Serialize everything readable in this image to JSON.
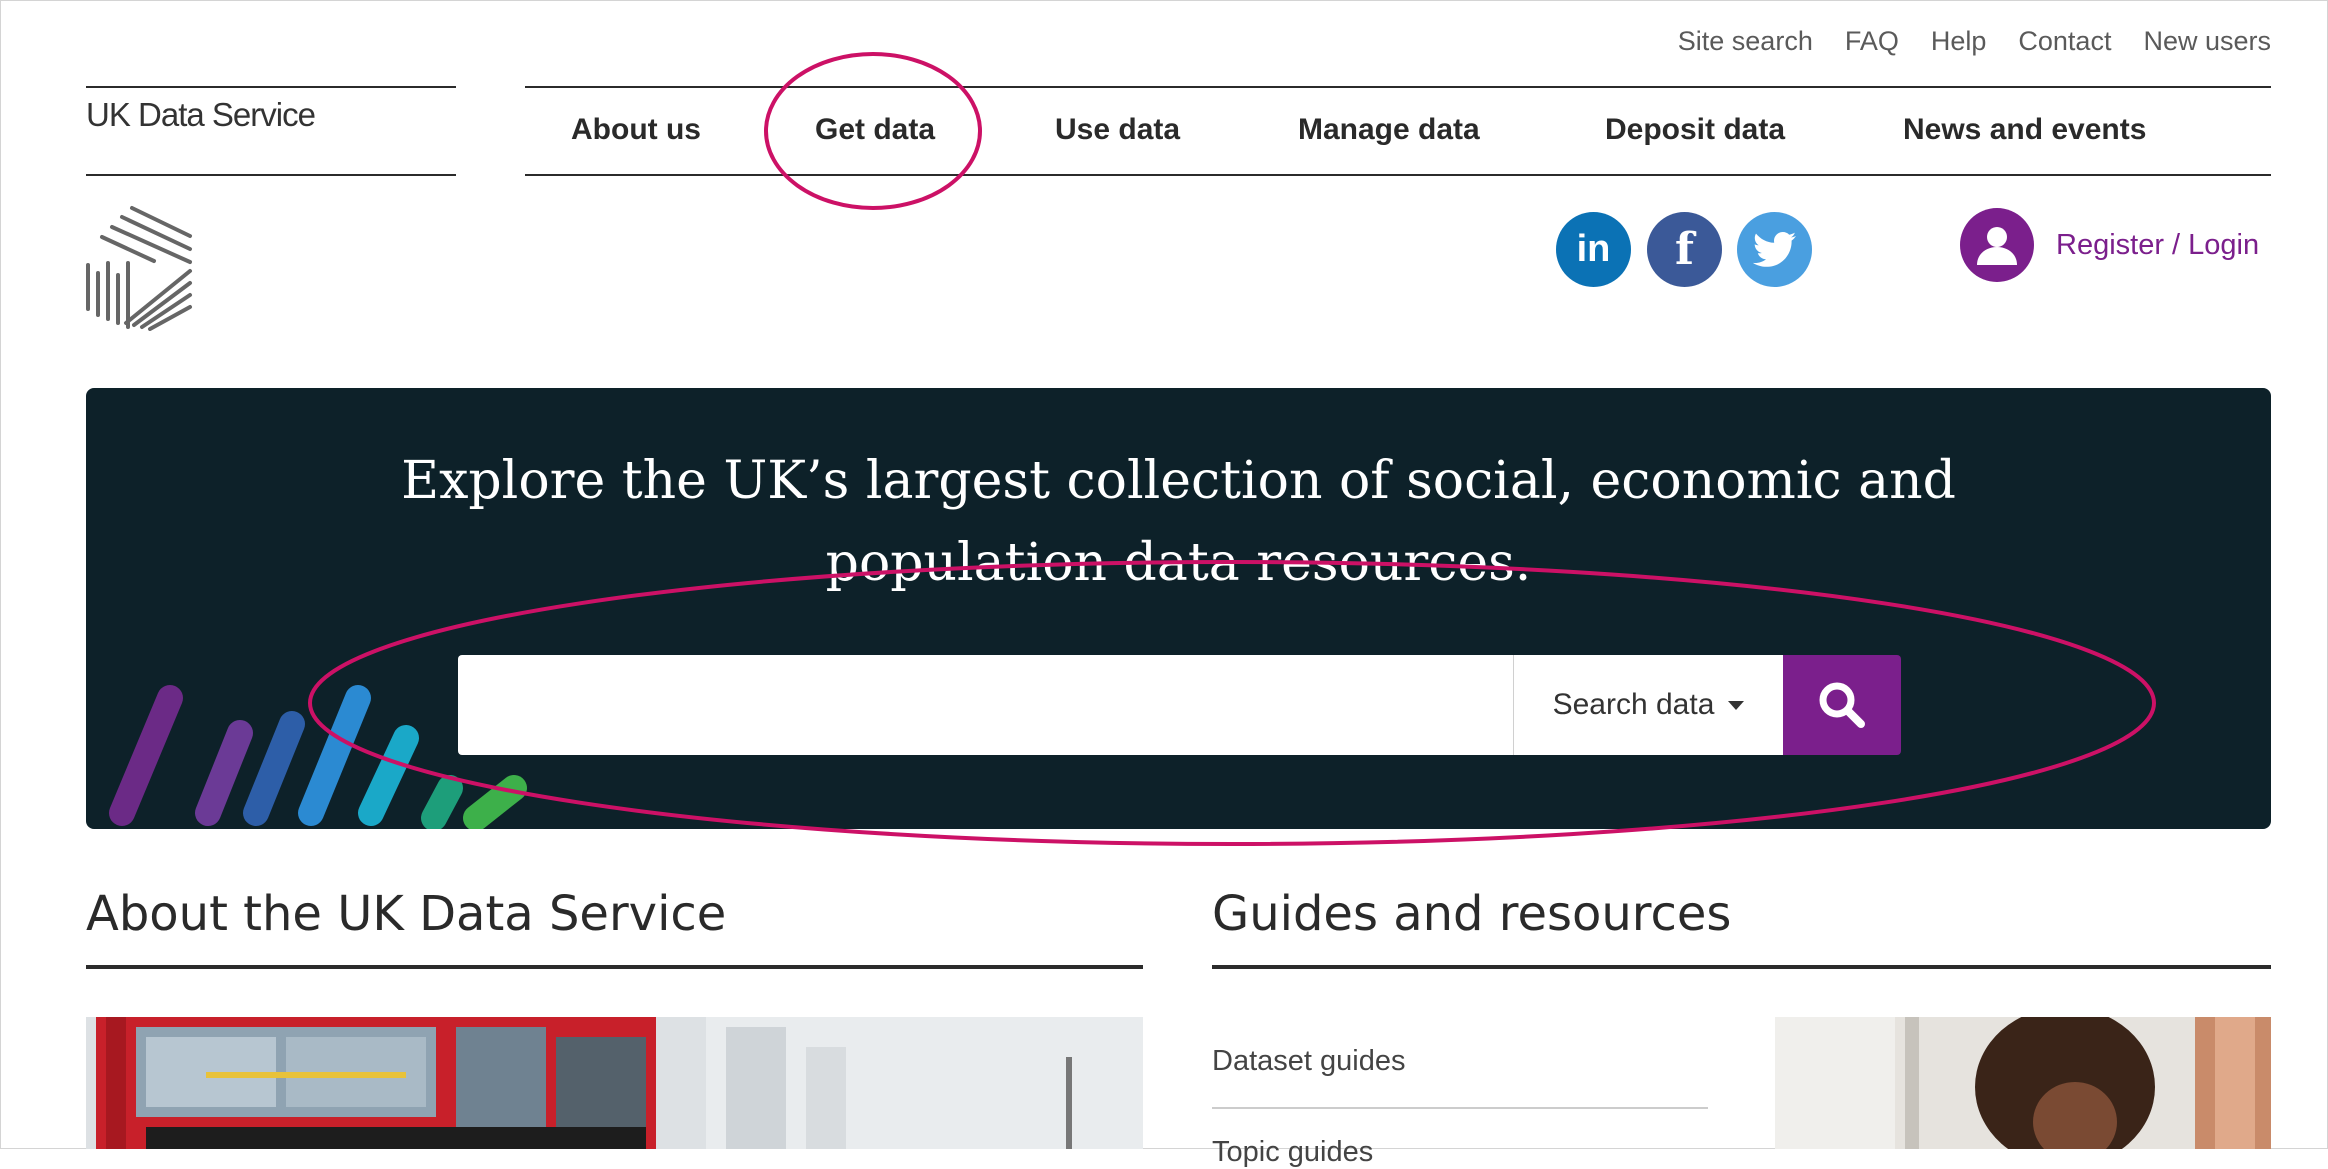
{
  "utility_nav": [
    "Site search",
    "FAQ",
    "Help",
    "Contact",
    "New users"
  ],
  "logo": {
    "text": "UK Data Service"
  },
  "main_nav": [
    "About us",
    "Get data",
    "Use data",
    "Manage data",
    "Deposit data",
    "News and events"
  ],
  "social": [
    {
      "icon": "linkedin-icon",
      "label": "in",
      "color": "#0b72b5"
    },
    {
      "icon": "facebook-icon",
      "label": "f",
      "color": "#3b5998"
    },
    {
      "icon": "twitter-icon",
      "label": "",
      "color": "#4a9fe0"
    }
  ],
  "account": {
    "label": "Register / Login",
    "icon": "user-avatar-icon",
    "color": "#7b1f8c"
  },
  "hero": {
    "title_line1": "Explore the UK’s largest collection of social, economic and",
    "title_line2": "population data resources.",
    "search_placeholder": "",
    "search_scope": "Search data",
    "search_icon": "magnifier-icon",
    "background": "#0d2129"
  },
  "sections": {
    "about_title": "About the UK Data Service",
    "guides_title": "Guides and resources",
    "guides_links": [
      "Dataset guides",
      "Topic guides"
    ]
  },
  "annotation_color": "#cc1166"
}
